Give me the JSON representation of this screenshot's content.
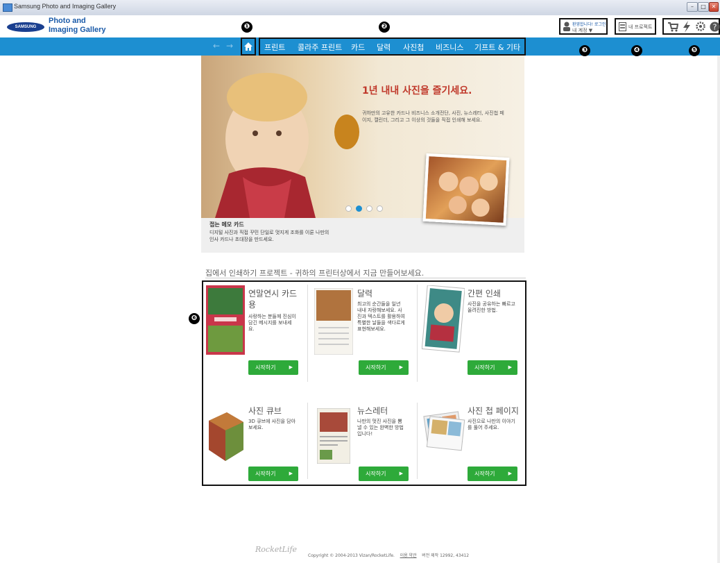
{
  "window": {
    "title": "Samsung Photo and Imaging Gallery",
    "controls": [
      "minimize",
      "maximize",
      "close"
    ]
  },
  "header": {
    "logo_text": "SAMSUNG",
    "app_name_line1": "Photo and",
    "app_name_line2": "Imaging Gallery",
    "account": {
      "greeting": "환영합니다! 로그인",
      "label": "내 계정 ▼"
    },
    "projects_label": "내 프로젝트",
    "tool_icons": [
      "cart-icon",
      "lightning-icon",
      "gear-icon",
      "help-icon"
    ]
  },
  "nav": {
    "back": "←",
    "forward": "→",
    "home_icon": "home-icon",
    "items": [
      "프린트",
      "콜라주 프린트",
      "카드",
      "달력",
      "사진첩",
      "비즈니스",
      "기프트 & 기타"
    ]
  },
  "callouts": [
    "❶",
    "❷",
    "❸",
    "❹",
    "❺",
    "❻"
  ],
  "hero": {
    "headline": "1년 내내 사진을 즐기세요.",
    "description": "귀하만의 고유한 카드나 비즈니스 소개전단, 사진, 뉴스레터, 사진첩 페이지, 캘린더, 그리고 그 이상의 것들을 직접 인쇄해 보세요.",
    "caption_title": "접는 메모 카드",
    "caption_line1": "디지털 사진과 직접 꾸민 단일로 멋지게 조화를 이룬 나만의",
    "caption_line2": "인사 카드나 초대장을 만드세요.",
    "slides": 4,
    "active_slide": 2
  },
  "section": {
    "title": "집에서 인쇄하기 프로젝트 - 귀하의 프린터상에서 지금 만들어보세요."
  },
  "cards": [
    {
      "title_line1": "연말연시 카드",
      "title_line2": "용",
      "desc_lines": [
        "사랑하는 분들께 진심이",
        "담긴 메시지를 보내세",
        "요."
      ],
      "button": "시작하기"
    },
    {
      "title_line1": "달력",
      "title_line2": "",
      "desc_lines": [
        "최고의 순간들을 일년",
        "내내 자랑해보세요. 사",
        "진과 텍스트를 활용하여",
        "특별한 날들을 색다르게",
        "표현해보세요."
      ],
      "button": "시작하기"
    },
    {
      "title_line1": "간편 인쇄",
      "title_line2": "",
      "desc_lines": [
        "사진을 공유하는 빠르고",
        "올려진한 방법."
      ],
      "button": "시작하기"
    },
    {
      "title_line1": "사진 큐브",
      "title_line2": "",
      "desc_lines": [
        "3D 큐브에 사진을 담아",
        "보세요."
      ],
      "button": "시작하기"
    },
    {
      "title_line1": "뉴스레터",
      "title_line2": "",
      "desc_lines": [
        "나만의 멋진 사진을 뽐",
        "낼 수 있는 완벽한 방법",
        "입니다!"
      ],
      "button": "시작하기"
    },
    {
      "title_line1": "사진 첩 페이지",
      "title_line2": "",
      "desc_lines": [
        "사진으로 나만의 이야기",
        "를 풀어 주세요."
      ],
      "button": "시작하기"
    }
  ],
  "footer": {
    "logo": "RocketLife",
    "copyright": "Copyright © 2004-2013 Vizan/RocketLife.",
    "terms": "이용 약관",
    "version": "버전 제작 12992, 43412"
  },
  "colors": {
    "nav_blue": "#1d8fd1",
    "button_green": "#2eaa3a",
    "headline_red": "#c0392b"
  }
}
